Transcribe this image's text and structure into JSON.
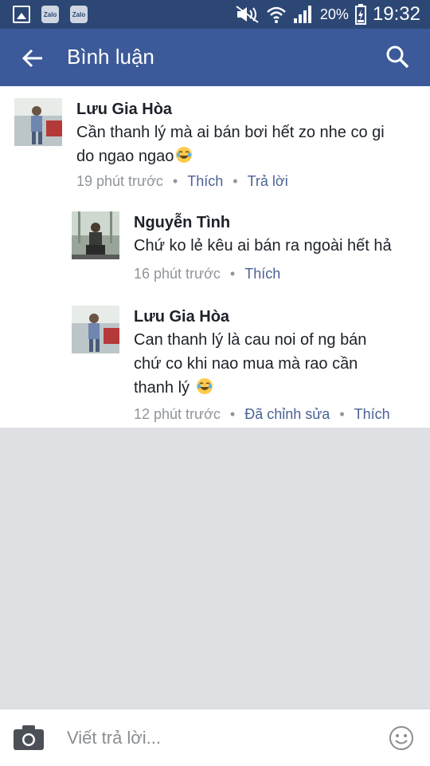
{
  "status_bar": {
    "battery": "20%",
    "time": "19:32",
    "apps": [
      "Zalo",
      "Zalo"
    ],
    "icons": [
      "gallery-icon",
      "zalo-icon",
      "zalo-icon",
      "mute-icon",
      "wifi-icon",
      "signal-icon",
      "battery-icon"
    ]
  },
  "header": {
    "title": "Bình luận",
    "back_icon": "arrow-left-icon",
    "search_icon": "search-icon"
  },
  "comments": [
    {
      "author": "Lưu Gia Hòa",
      "text_lines": [
        "Cần thanh lý  mà ai bán bơi hết zo nhe co gi",
        "do ngao ngao"
      ],
      "emoji": "laughing-tears",
      "time": "19 phút trước",
      "actions": [
        "Thích",
        "Trả lời"
      ]
    },
    {
      "author": "Nguyễn Tình",
      "text_lines": [
        "Chứ ko lẻ kêu ai bán ra ngoài hết hả"
      ],
      "time": "16 phút trước",
      "actions": [
        "Thích"
      ]
    },
    {
      "author": "Lưu Gia Hòa",
      "text_lines": [
        "Can thanh lý là cau noi of ng bán",
        "chứ co khi nao mua mà rao cần",
        "thanh lý"
      ],
      "emoji": "laughing-tears",
      "time": "12 phút trước",
      "actions": [
        "Đã chỉnh sửa",
        "Thích"
      ]
    }
  ],
  "composer": {
    "placeholder": "Viết trả lời...",
    "camera_icon": "camera-icon",
    "sticker_icon": "smiley-icon"
  },
  "colors": {
    "status_bar": "#2d4775",
    "header": "#3c5a99",
    "link": "#4b6195",
    "meta_text": "#90949c",
    "background": "#dfe0e4"
  }
}
